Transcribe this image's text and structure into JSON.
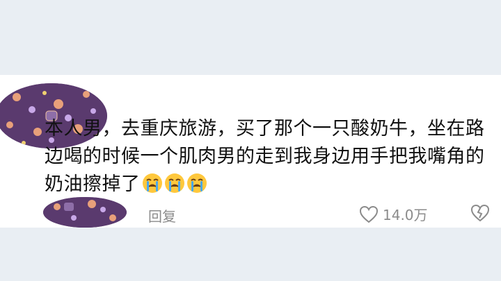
{
  "comment": {
    "text": "本人男，去重庆旅游，买了那个一只酸奶牛，坐在路边喝的时候一个肌肉男的走到我身边用手把我嘴角的奶油擦掉了",
    "emojis": [
      "loudly-crying-face",
      "loudly-crying-face",
      "loudly-crying-face"
    ]
  },
  "actions": {
    "reply_label": "回复",
    "like_count": "14.0万"
  },
  "colors": {
    "background": "#e9eef3",
    "card": "#ffffff",
    "text": "#111111",
    "muted": "#8b8b8b",
    "avatar": "#5a3a6e"
  }
}
